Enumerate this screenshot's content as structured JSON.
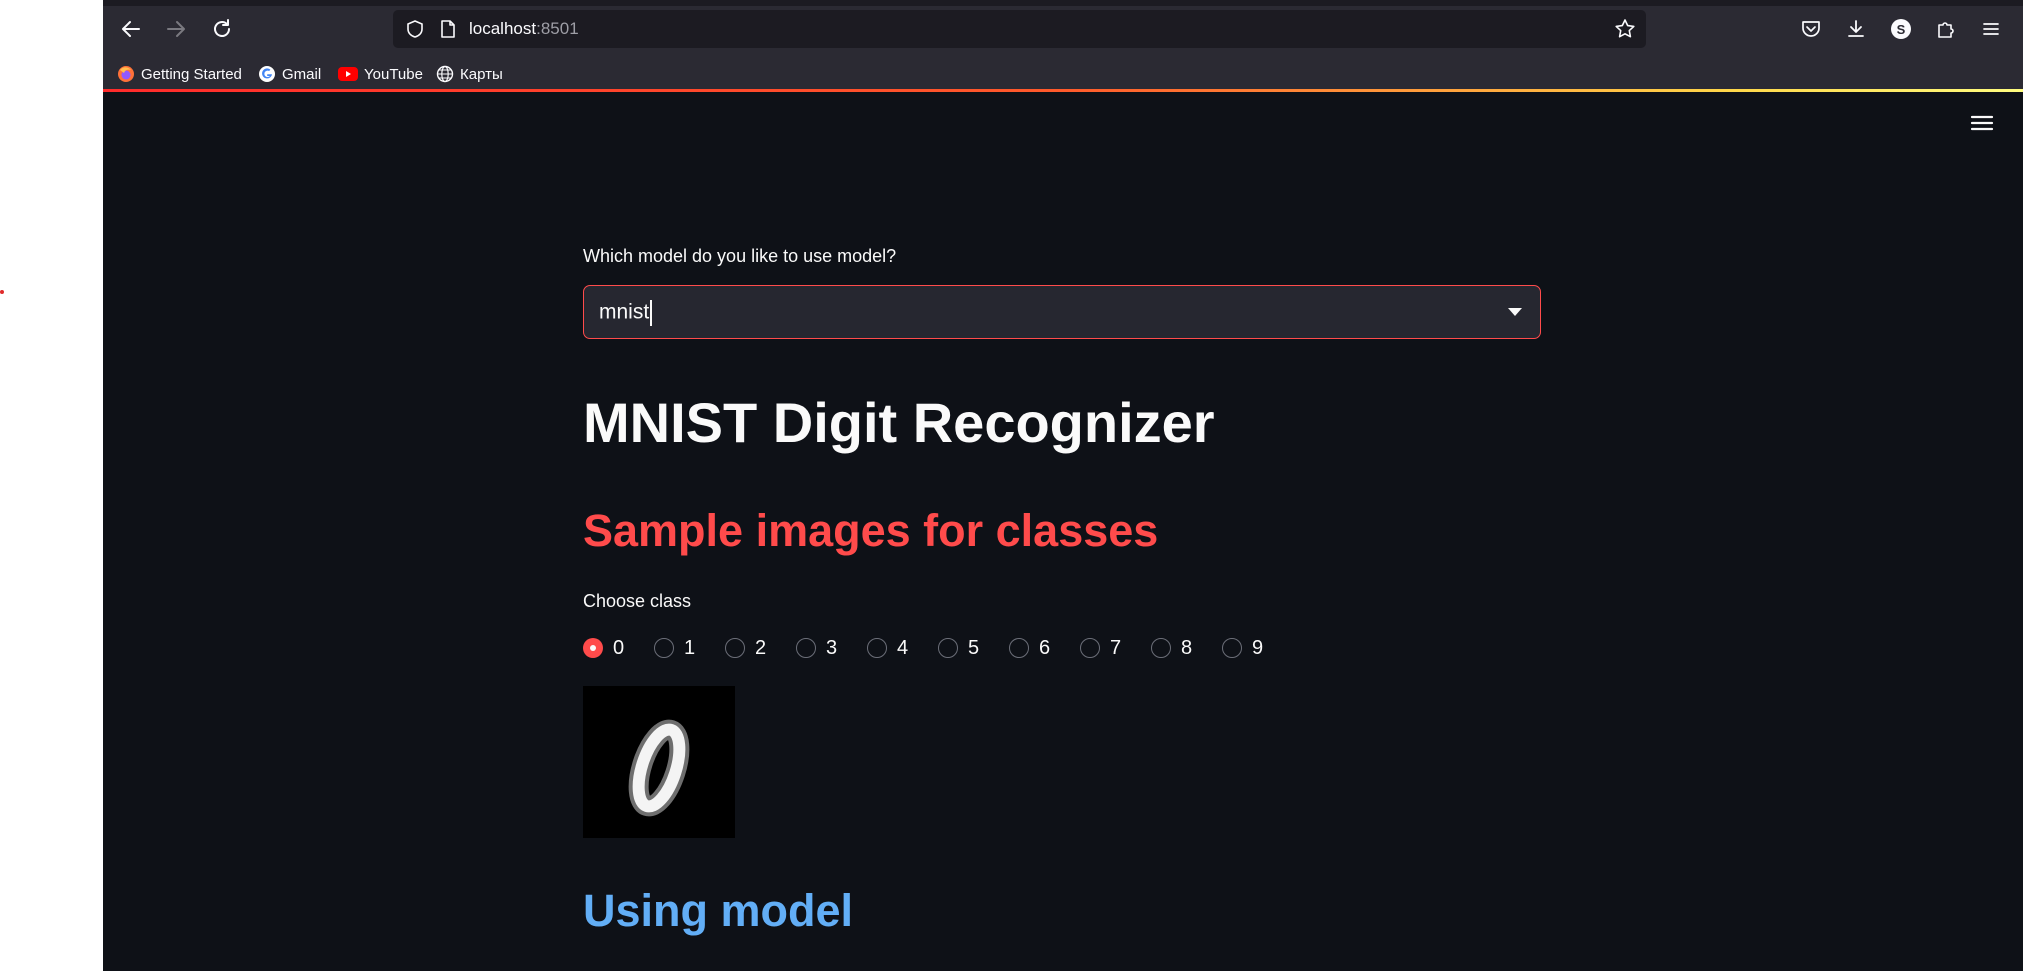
{
  "browser": {
    "url_host": "localhost",
    "url_port": ":8501",
    "bookmarks": [
      {
        "label": "Getting Started",
        "icon": "firefox-icon"
      },
      {
        "label": "Gmail",
        "icon": "google-icon"
      },
      {
        "label": "YouTube",
        "icon": "youtube-icon"
      },
      {
        "label": "Карты",
        "icon": "globe-icon"
      }
    ],
    "profile_initial": "S"
  },
  "app": {
    "model_select_label": "Which model do you like to use model?",
    "model_select_value": "mnist",
    "title": "MNIST Digit Recognizer",
    "sample_header": "Sample images for classes",
    "class_radio_label": "Choose class",
    "class_options": [
      "0",
      "1",
      "2",
      "3",
      "4",
      "5",
      "6",
      "7",
      "8",
      "9"
    ],
    "class_selected": "0",
    "sample_image_depicts": "handwritten digit 0",
    "model_header": "Using model"
  },
  "colors": {
    "app_background": "#0e1117",
    "accent_red": "#ff4b4b",
    "header_blue": "#62aef6",
    "chrome_background": "#2b2a33"
  }
}
